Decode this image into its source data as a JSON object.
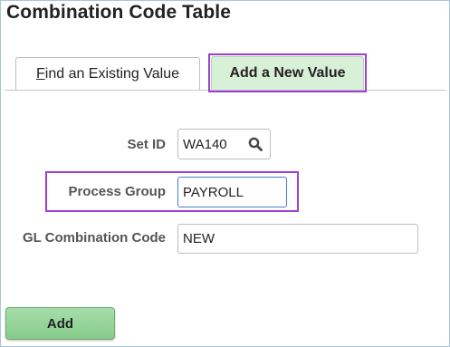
{
  "page": {
    "title": "Combination Code Table"
  },
  "tabs": [
    {
      "label_mnemonic": "F",
      "label_rest": "ind an Existing Value",
      "active": false
    },
    {
      "label": "Add a New Value",
      "active": true
    }
  ],
  "form": {
    "set_id": {
      "label": "Set ID",
      "value": "WA140"
    },
    "process_group": {
      "label": "Process Group",
      "value": "PAYROLL"
    },
    "gl_combination_code": {
      "label": "GL Combination Code",
      "value": "NEW"
    }
  },
  "actions": {
    "add_label": "Add"
  },
  "colors": {
    "highlight": "#9b3fd0",
    "active_tab": "#d8f0d8",
    "add_button": "#96d49a",
    "label_text": "#555555"
  },
  "icons": {
    "set_id_lookup": "search-icon"
  }
}
